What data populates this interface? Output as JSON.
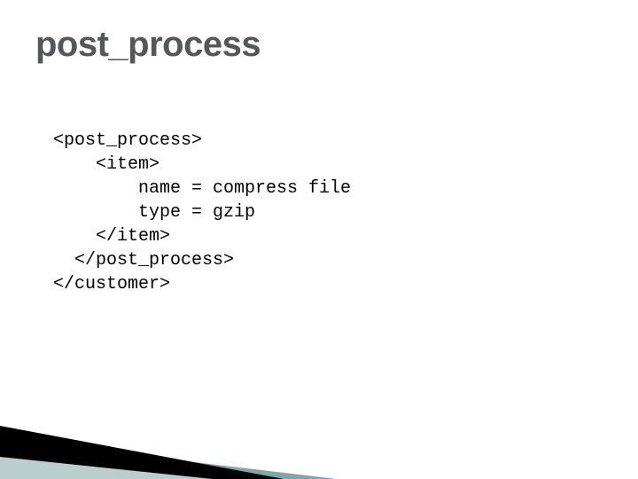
{
  "title": "post_process",
  "code": {
    "l1": "<post_process>",
    "l2": "    <item>",
    "l3": "        name = compress file",
    "l4": "        type = gzip",
    "l5": "    </item>",
    "l6": "  </post_process>",
    "l7": "</customer>"
  }
}
